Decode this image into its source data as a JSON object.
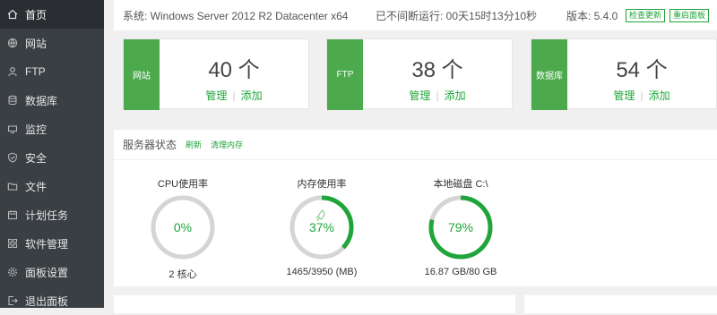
{
  "sidebar": {
    "items": [
      {
        "label": "首页",
        "icon": "home-icon",
        "active": true
      },
      {
        "label": "网站",
        "icon": "globe-icon"
      },
      {
        "label": "FTP",
        "icon": "ftp-user-icon"
      },
      {
        "label": "数据库",
        "icon": "database-icon"
      },
      {
        "label": "监控",
        "icon": "monitor-icon"
      },
      {
        "label": "安全",
        "icon": "shield-icon"
      },
      {
        "label": "文件",
        "icon": "folder-icon"
      },
      {
        "label": "计划任务",
        "icon": "calendar-icon"
      },
      {
        "label": "软件管理",
        "icon": "grid-icon"
      },
      {
        "label": "面板设置",
        "icon": "gear-icon"
      },
      {
        "label": "退出面板",
        "icon": "logout-icon"
      }
    ]
  },
  "topbar": {
    "system": "系统: Windows Server 2012 R2 Datacenter x64",
    "uptime": "已不间断运行: 00天15时13分10秒",
    "version": "版本: 5.4.0",
    "check_update": "检查更新",
    "restart_panel": "重启面板"
  },
  "cards": [
    {
      "tag": "网站",
      "count": "40 个",
      "manage": "管理",
      "add": "添加"
    },
    {
      "tag": "FTP",
      "count": "38 个",
      "manage": "管理",
      "add": "添加"
    },
    {
      "tag": "数据库",
      "count": "54 个",
      "manage": "管理",
      "add": "添加"
    }
  ],
  "status": {
    "title": "服务器状态",
    "refresh": "刷新",
    "clear_memory": "清理内存",
    "gauges": [
      {
        "title": "CPU使用率",
        "value": "0%",
        "fraction": 0.0,
        "sub": "2 核心"
      },
      {
        "title": "内存使用率",
        "value": "37%",
        "fraction": 0.37,
        "sub": "1465/3950 (MB)"
      },
      {
        "title": "本地磁盘 C:\\",
        "value": "79%",
        "fraction": 0.79,
        "sub": "16.87 GB/80 GB"
      }
    ]
  },
  "colors": {
    "accent": "#20a53a",
    "sidebar": "#3a3f44",
    "tag": "#4caa4c",
    "track": "#d5d5d5"
  }
}
